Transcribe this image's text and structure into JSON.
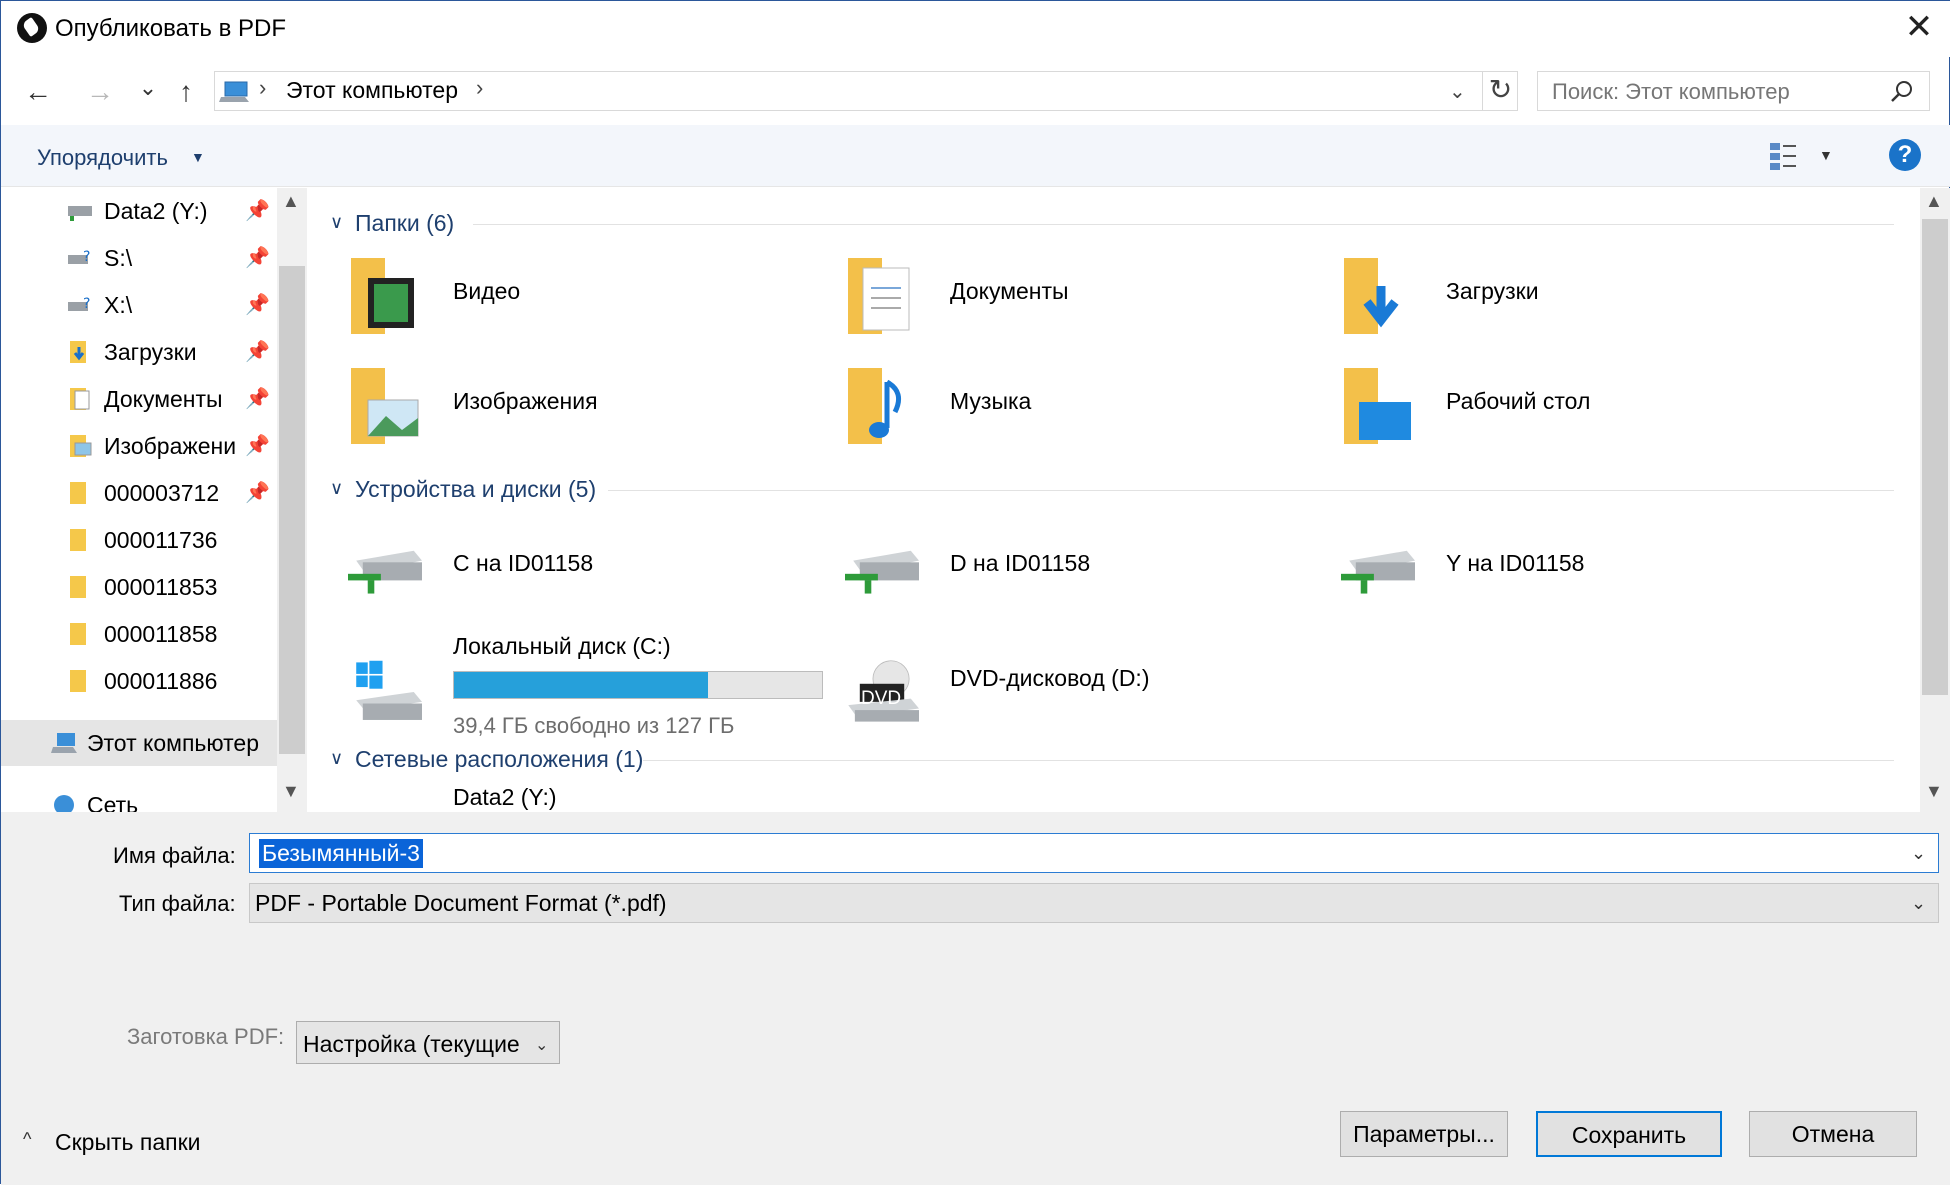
{
  "window": {
    "title": "Опубликовать в PDF",
    "close_glyph": "✕"
  },
  "nav": {
    "back": "←",
    "forward": "→",
    "recent": "⌄",
    "up": "↑"
  },
  "address": {
    "location": "Этот компьютер",
    "sep": "›",
    "dropdown": "⌄",
    "refresh": "↻"
  },
  "search": {
    "placeholder": "Поиск: Этот компьютер"
  },
  "toolbar": {
    "organize": "Упорядочить",
    "organize_caret": "▼",
    "view_caret": "▼",
    "help": "?"
  },
  "sidebar": {
    "pin": "📌",
    "items": [
      {
        "label": "Data2 (Y:)",
        "icon": "network-drive-icon",
        "pinned": true
      },
      {
        "label": "S:\\",
        "icon": "disconnected-drive-icon",
        "pinned": true
      },
      {
        "label": "X:\\",
        "icon": "disconnected-drive-icon",
        "pinned": true
      },
      {
        "label": "Загрузки",
        "icon": "downloads-folder-icon",
        "pinned": true
      },
      {
        "label": "Документы",
        "icon": "documents-folder-icon",
        "pinned": true
      },
      {
        "label": "Изображени",
        "icon": "pictures-folder-icon",
        "pinned": true
      },
      {
        "label": "000003712",
        "icon": "folder-icon",
        "pinned": true
      },
      {
        "label": "000011736",
        "icon": "folder-icon",
        "pinned": false
      },
      {
        "label": "000011853",
        "icon": "folder-icon",
        "pinned": false
      },
      {
        "label": "000011858",
        "icon": "folder-icon",
        "pinned": false
      },
      {
        "label": "000011886",
        "icon": "folder-icon",
        "pinned": false
      },
      {
        "label": "Этот компьютер",
        "icon": "this-pc-icon",
        "pinned": false,
        "selected": true
      },
      {
        "label": "Сеть",
        "icon": "network-icon",
        "pinned": false
      }
    ]
  },
  "content": {
    "groups": [
      {
        "label": "Папки (6)"
      },
      {
        "label": "Устройства и диски (5)"
      },
      {
        "label": "Сетевые расположения (1)"
      }
    ],
    "folders": [
      "Видео",
      "Документы",
      "Загрузки",
      "Изображения",
      "Музыка",
      "Рабочий стол"
    ],
    "drives": [
      {
        "label": "C на ID01158"
      },
      {
        "label": "D на ID01158"
      },
      {
        "label": "Y на ID01158"
      },
      {
        "label": "Локальный диск (C:)",
        "free": "39,4 ГБ свободно из 127 ГБ",
        "used_fraction": 0.69
      },
      {
        "label": "DVD-дисковод (D:)",
        "badge": "DVD"
      }
    ],
    "network": [
      "Data2 (Y:)"
    ]
  },
  "bottom": {
    "filename_label": "Имя файла:",
    "filename_value": "Безымянный-3",
    "filetype_label": "Тип файла:",
    "filetype_value": "PDF - Portable Document Format (*.pdf)",
    "preset_label": "Заготовка PDF:",
    "preset_value": "Настройка (текущие",
    "hide_folders": "Скрыть папки",
    "dropdown": "⌄",
    "chev_up": "^"
  },
  "buttons": {
    "params": "Параметры...",
    "save": "Сохранить",
    "cancel": "Отмена"
  },
  "colors": {
    "accent": "#0078d7",
    "group_text": "#1e3f6e",
    "drive_bar": "#26a0da"
  }
}
